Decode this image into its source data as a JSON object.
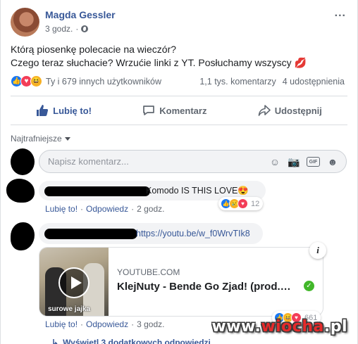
{
  "post": {
    "author": "Magda Gessler",
    "time": "3 godz.",
    "more": "...",
    "text_line1": "Którą piosenkę polecacie na wieczór?",
    "text_line2": "Czego teraz słuchacie? Wrzućie linki z YT. Posłuchamy wszyscy",
    "text_emoji": "💋",
    "reactions_label": "Ty i 679 innych użytkowników",
    "comments_count": "1,1 tys. komentarzy",
    "shares_count": "4 udostępnienia",
    "reaction_icons": [
      "like-icon",
      "love-icon",
      "haha-icon"
    ]
  },
  "actions": {
    "like": "Lubię to!",
    "comment": "Komentarz",
    "share": "Udostępnij"
  },
  "sort": {
    "label": "Najtrafniejsze"
  },
  "composer": {
    "placeholder": "Napisz komentarz..."
  },
  "comments": [
    {
      "text": "Komodo IS THIS LOVE",
      "emoji": "😍",
      "like": "Lubię to!",
      "reply": "Odpowiedz",
      "time": "2 godz.",
      "reaction_count": "12",
      "sep": "·"
    },
    {
      "link": "https://youtu.be/w_f0WrvTIk8",
      "like": "Lubię to!",
      "reply": "Odpowiedz",
      "time": "3 godz.",
      "reaction_count": "661",
      "sep": "·",
      "preview": {
        "domain": "YOUTUBE.COM",
        "title": "KlejNuty - Bende Go Zjad! (prod.…",
        "thumb_caption": "surowe jajka"
      }
    }
  ],
  "view_more": "Wyświetl 3 dodatkowych odpowiedzi",
  "watermark": {
    "part1": "www.",
    "part2": "wiocha",
    "part3": ".pl"
  },
  "colors": {
    "link": "#385898",
    "like_blue": "#1877f2",
    "love_red": "#f33e58",
    "haha_yellow": "#f7b125",
    "bubble_bg": "#f2f3f5"
  }
}
